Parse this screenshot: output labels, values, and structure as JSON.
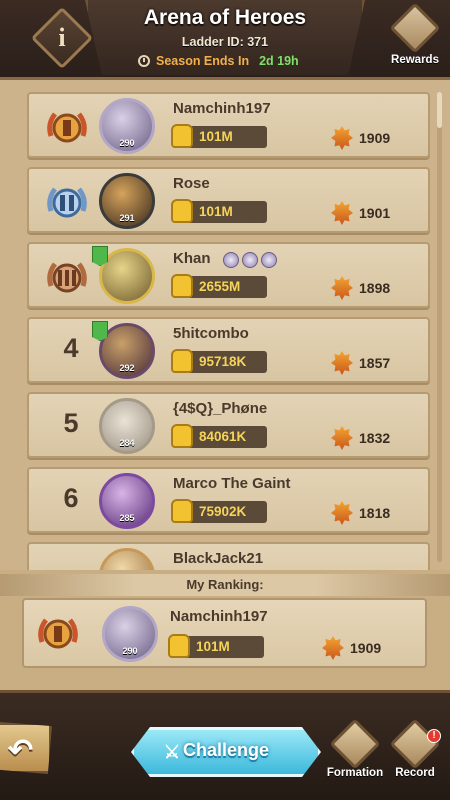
{
  "header": {
    "title": "Arena of Heroes",
    "ladder": "Ladder ID: 371",
    "season_label": "Season Ends In",
    "season_time": "2d 19h",
    "info_glyph": "i",
    "rewards_label": "Rewards"
  },
  "leaderboard": [
    {
      "rank": "",
      "emblem": "gold-laurel-rank-1",
      "name": "Namchinh197",
      "level": "290",
      "power": "101M",
      "trophies": "1909"
    },
    {
      "rank": "",
      "emblem": "silver-laurel-rank-2",
      "name": "Rose",
      "level": "291",
      "power": "101M",
      "trophies": "1901"
    },
    {
      "rank": "",
      "emblem": "bronze-laurel-rank-3",
      "name": "Khan",
      "level": "",
      "power": "2655M",
      "trophies": "1898"
    },
    {
      "rank": "4",
      "emblem": "",
      "name": "5hitcombo",
      "level": "292",
      "power": "95718K",
      "trophies": "1857"
    },
    {
      "rank": "5",
      "emblem": "",
      "name": "{4$Q}_Phøne",
      "level": "284",
      "power": "84061K",
      "trophies": "1832"
    },
    {
      "rank": "6",
      "emblem": "",
      "name": "Marco The Gaint",
      "level": "285",
      "power": "75902K",
      "trophies": "1818"
    },
    {
      "rank": "",
      "emblem": "",
      "name": "BlackJack21",
      "level": "",
      "power": "",
      "trophies": ""
    }
  ],
  "my_ranking": {
    "label": "My Ranking:",
    "name": "Namchinh197",
    "level": "290",
    "power": "101M",
    "trophies": "1909"
  },
  "footer": {
    "challenge_label": "Challenge",
    "formation_label": "Formation",
    "record_label": "Record",
    "record_alert": "!",
    "back_glyph": "↶",
    "swords_glyph": "⚔"
  },
  "colors": {
    "panel": "#cdb38b",
    "row": "#e3d3b5",
    "power_text": "#f5d45a",
    "challenge": "#3cb9dc",
    "season_time": "#7fe06a"
  }
}
